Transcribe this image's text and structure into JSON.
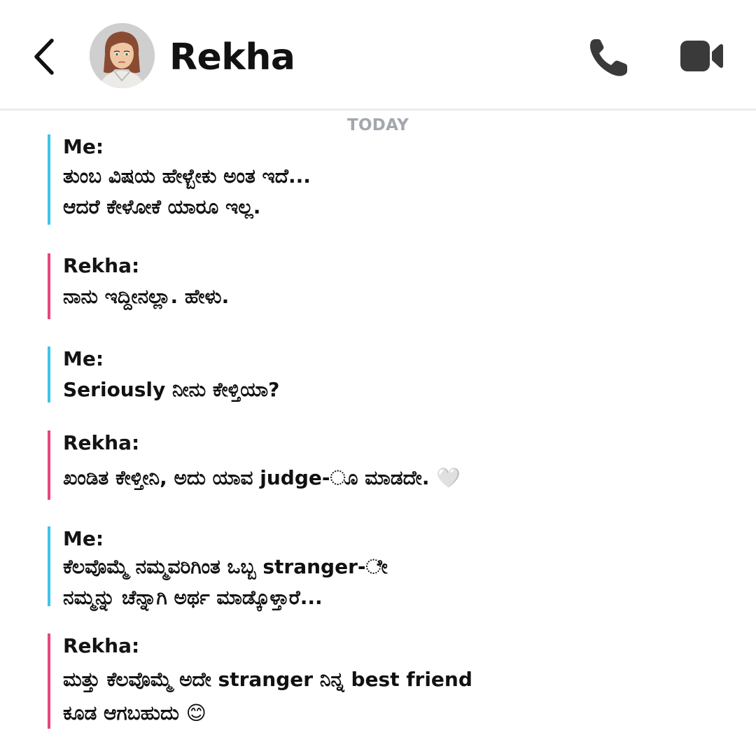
{
  "header": {
    "contact_name": "Rekha",
    "back_icon": "chevron-left-icon",
    "call_icon": "phone-icon",
    "video_icon": "video-camera-icon"
  },
  "date_divider": "TODAY",
  "colors": {
    "me_accent": "#3ec6e8",
    "rekha_accent": "#e8457e",
    "divider_text": "#a3a7ad",
    "icon": "#3a3a3a"
  },
  "messages": [
    {
      "sender": "Me:",
      "lines": [
        "ತುಂಬ ವಿಷಯ ಹೇಳ್ಬೇಕು ಅಂತ ಇದೆ...",
        "ಆದರೆ ಕೇಳೋಕೆ ಯಾರೂ ಇಲ್ಲ."
      ]
    },
    {
      "sender": "Rekha:",
      "lines": [
        "ನಾನು ಇದ್ದೀನಲ್ಲಾ. ಹೇಳು."
      ]
    },
    {
      "sender": "Me:",
      "lines": [
        "Seriously ನೀನು ಕೇಳ್ತಿಯಾ?"
      ]
    },
    {
      "sender": "Rekha:",
      "lines": [
        "ಖಂಡಿತ ಕೇಳ್ತೀನಿ, ಅದು ಯಾವ judge-ೂ ಮಾಡದೇ. 🤍"
      ]
    },
    {
      "sender": "Me:",
      "lines": [
        "ಕೆಲವೊಮ್ಮೆ ನಮ್ಮವರಿಗಿಂತ ಒಬ್ಬ stranger-ೇ",
        "ನಮ್ಮನ್ನು ಚೆನ್ನಾಗಿ ಅರ್ಥ ಮಾಡ್ಕೊಳ್ತಾರೆ..."
      ]
    },
    {
      "sender": "Rekha:",
      "lines": [
        "ಮತ್ತು ಕೆಲವೊಮ್ಮೆ ಅದೇ stranger ನಿನ್ನ best friend",
        "ಕೂಡ ಆಗಬಹುದು 😊"
      ]
    }
  ]
}
